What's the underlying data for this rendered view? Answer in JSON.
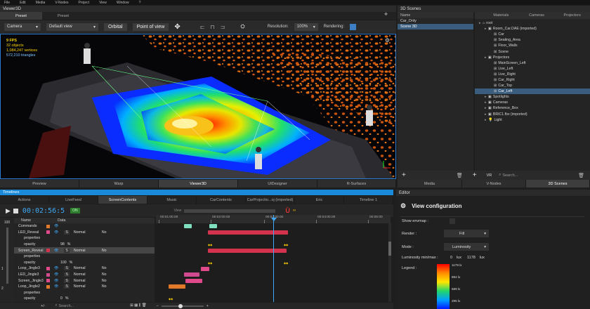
{
  "menu": [
    "File",
    "Edit",
    "Media",
    "V-Nodes",
    "Project",
    "View",
    "Window",
    "?"
  ],
  "viewer": {
    "title": "Viewer3D",
    "tabs": [
      "Preset",
      "Preset"
    ],
    "camera_label": "Camera",
    "view_select": "Default view",
    "orbital": "Orbital",
    "point_of_view": "Point of view",
    "resolution_label": "Resolution:",
    "resolution_value": "100%",
    "rendering_label": "Rendering:",
    "stats": [
      "9 FPS",
      "32 objects",
      "1,084,247 vertices",
      "572,210 triangles"
    ],
    "bottom_tabs": [
      "Preview",
      "Warp",
      "Viewer3D",
      "UIDesigner",
      "R-Surfaces"
    ]
  },
  "scenes": {
    "title": "3D Scenes",
    "name_header": "Name",
    "items": [
      "Car_Only",
      "Scene 3D"
    ],
    "tabs": [
      "Materials",
      "Cameras",
      "Projectors"
    ],
    "tree": [
      {
        "label": "root",
        "indent": 0
      },
      {
        "label": "Room_Car.DAE (imported)",
        "indent": 1
      },
      {
        "label": "Car",
        "indent": 2
      },
      {
        "label": "Seating_Area",
        "indent": 2
      },
      {
        "label": "Floor_Walls",
        "indent": 2
      },
      {
        "label": "Scene",
        "indent": 2
      },
      {
        "label": "Projectors",
        "indent": 1
      },
      {
        "label": "MainScreen_Left",
        "indent": 2
      },
      {
        "label": "Live_Left",
        "indent": 2
      },
      {
        "label": "Live_Right",
        "indent": 2
      },
      {
        "label": "Car_Right",
        "indent": 2
      },
      {
        "label": "Car_Top",
        "indent": 2
      },
      {
        "label": "Car_Left",
        "indent": 2
      },
      {
        "label": "Spotlights",
        "indent": 1
      },
      {
        "label": "Cameras",
        "indent": 1
      },
      {
        "label": "Reference_Box",
        "indent": 1
      },
      {
        "label": "BRIC1.fbx (imported)",
        "indent": 1
      },
      {
        "label": "Light",
        "indent": 1
      }
    ],
    "vr_label": "VR",
    "search_placeholder": "Search...",
    "bottom_tabs": [
      "Media",
      "V-Nodes",
      "3D Scenes"
    ]
  },
  "timelines": {
    "title": "Timelines",
    "tabs": [
      "Actions",
      "LiveFeed",
      "ScreenContents",
      "Music",
      "CarContents",
      "CarProjectio...oj (imported)",
      "Eric",
      "Timeline 1"
    ],
    "timecode": "00:02:56:5",
    "on_badge": "ON",
    "zoom_value": "100",
    "name_header": "Name",
    "data_header": "Data",
    "view_label": "View",
    "ruler": [
      "00:01:00.00",
      "00:02:00.00",
      "00:03:00.00",
      "00:04:00.00",
      "00:05:00"
    ],
    "rows": [
      {
        "name": "Commands",
        "type": "",
        "arrow": "",
        "value": "",
        "blend": "",
        "none": ""
      },
      {
        "name": "LED_Reveal",
        "type": "S",
        "arrow": "",
        "value": "",
        "blend": "Normal",
        "none": "No"
      },
      {
        "name": "properties",
        "type": "",
        "arrow": "",
        "value": "",
        "blend": "",
        "none": ""
      },
      {
        "name": "opacity",
        "type": "",
        "arrow": "",
        "value": "98",
        "blend": "",
        "none": "%"
      },
      {
        "name": "Screen_Reveal",
        "type": "S",
        "arrow": "",
        "value": "",
        "blend": "Normal",
        "none": "No"
      },
      {
        "name": "properties",
        "type": "",
        "arrow": "",
        "value": "",
        "blend": "",
        "none": ""
      },
      {
        "name": "opacity",
        "type": "",
        "arrow": "",
        "value": "100",
        "blend": "",
        "none": "%"
      },
      {
        "name": "Loop_Jingle3",
        "type": "S",
        "arrow": "",
        "value": "",
        "blend": "Normal",
        "none": "No"
      },
      {
        "name": "LED_Jingle3",
        "type": "S",
        "arrow": "",
        "value": "",
        "blend": "Normal",
        "none": "No"
      },
      {
        "name": "Screen_Jingle3",
        "type": "S",
        "arrow": "",
        "value": "",
        "blend": "Normal",
        "none": "No"
      },
      {
        "name": "Loop_Jingle2",
        "type": "S",
        "arrow": "",
        "value": "",
        "blend": "Normal",
        "none": "No"
      },
      {
        "name": "properties",
        "type": "",
        "arrow": "",
        "value": "",
        "blend": "",
        "none": ""
      },
      {
        "name": "opacity",
        "type": "",
        "arrow": "",
        "value": "0",
        "blend": "",
        "none": "%"
      }
    ],
    "side_numbers": [
      "100",
      "1",
      "2"
    ],
    "search_placeholder": "Search...",
    "plusminus": "+/-"
  },
  "editor": {
    "title": "Editor",
    "heading": "View configuration",
    "show_envmap": "Show envmap :",
    "render_label": "Render :",
    "render_value": "Fill",
    "mode_label": "Mode :",
    "mode_value": "Luminosity",
    "lum_label": "Luminosity min/max :",
    "lum_min": "0",
    "lum_unit1": "lux",
    "lum_max": "1178",
    "lum_unit2": "lux",
    "legend_label": "Legend :",
    "legend_values": [
      "1178 lx",
      "884 lx",
      "589 lx",
      "295 lx"
    ]
  },
  "colors": {
    "accent": "#1e8ad6",
    "timeline_red": "#d3334c",
    "timeline_pink": "#d04a8e",
    "timeline_orange": "#e07a2a",
    "timeline_green": "#7fe0c0"
  }
}
